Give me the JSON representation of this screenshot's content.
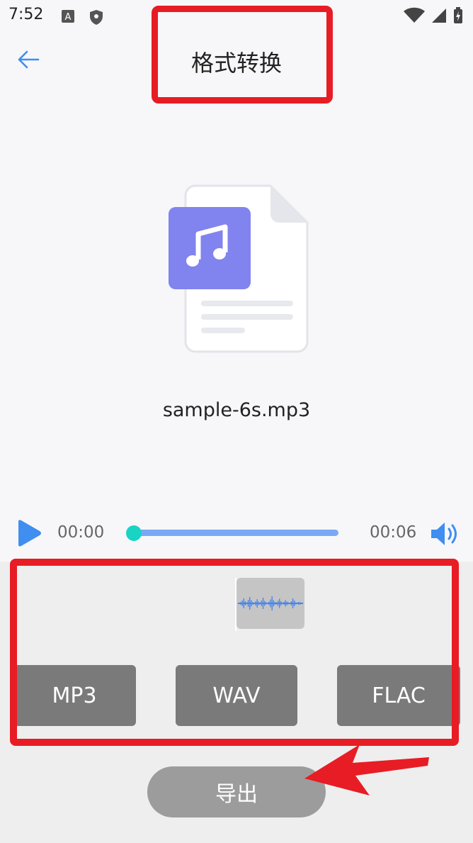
{
  "status_bar": {
    "time": "7:52"
  },
  "header": {
    "title": "格式转换"
  },
  "file": {
    "name": "sample-6s.mp3"
  },
  "player": {
    "current_time": "00:00",
    "end_time": "00:06",
    "progress": 0.0
  },
  "formats": [
    "MP3",
    "WAV",
    "FLAC"
  ],
  "export_label": "导出",
  "colors": {
    "accent": "#3f8ef0",
    "annotation": "#e81c24",
    "format_bg": "#7a7a7a",
    "music_tile": "#8183ee"
  }
}
